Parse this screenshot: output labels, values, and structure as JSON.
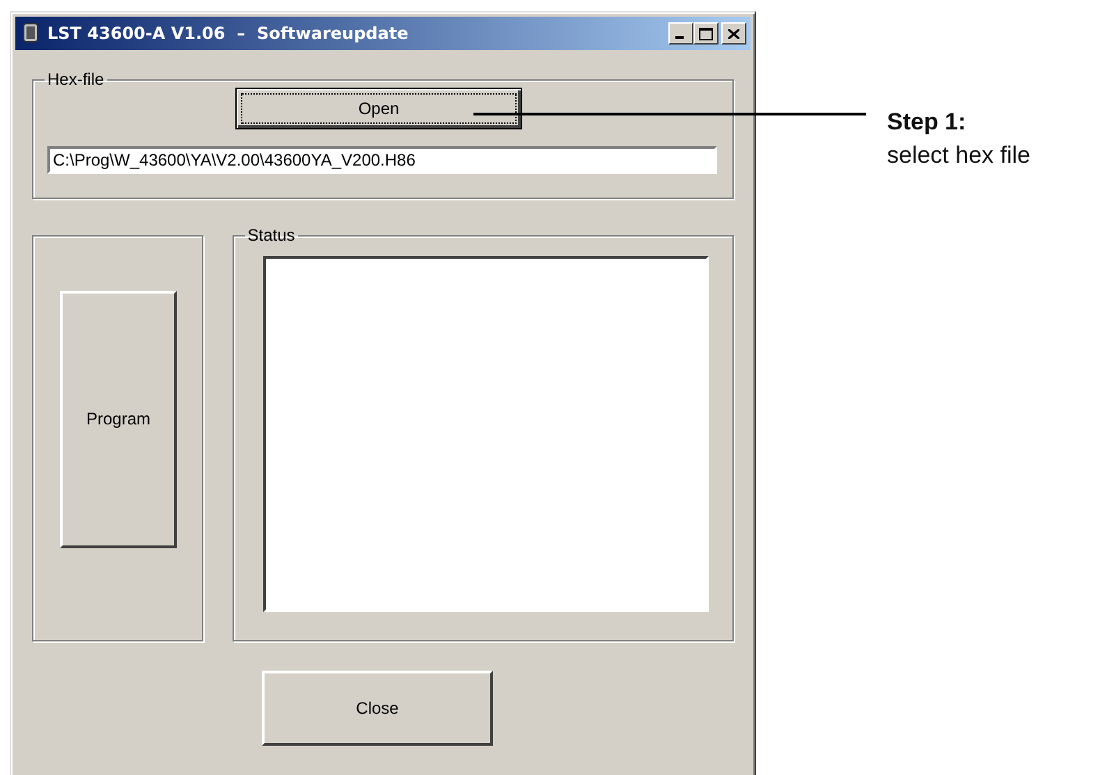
{
  "window": {
    "title": "LST 43600-A V1.06  –  Softwareupdate"
  },
  "hex_file": {
    "legend": "Hex-file",
    "open_button": {
      "label": "Open",
      "focused": true
    },
    "path": "C:\\Prog\\W_43600\\YA\\V2.00\\43600YA_V200.H86"
  },
  "program_button": "Program",
  "status": {
    "legend": "Status"
  },
  "close_button": "Close",
  "callout": {
    "title": "Step 1:",
    "text": "select hex file"
  }
}
